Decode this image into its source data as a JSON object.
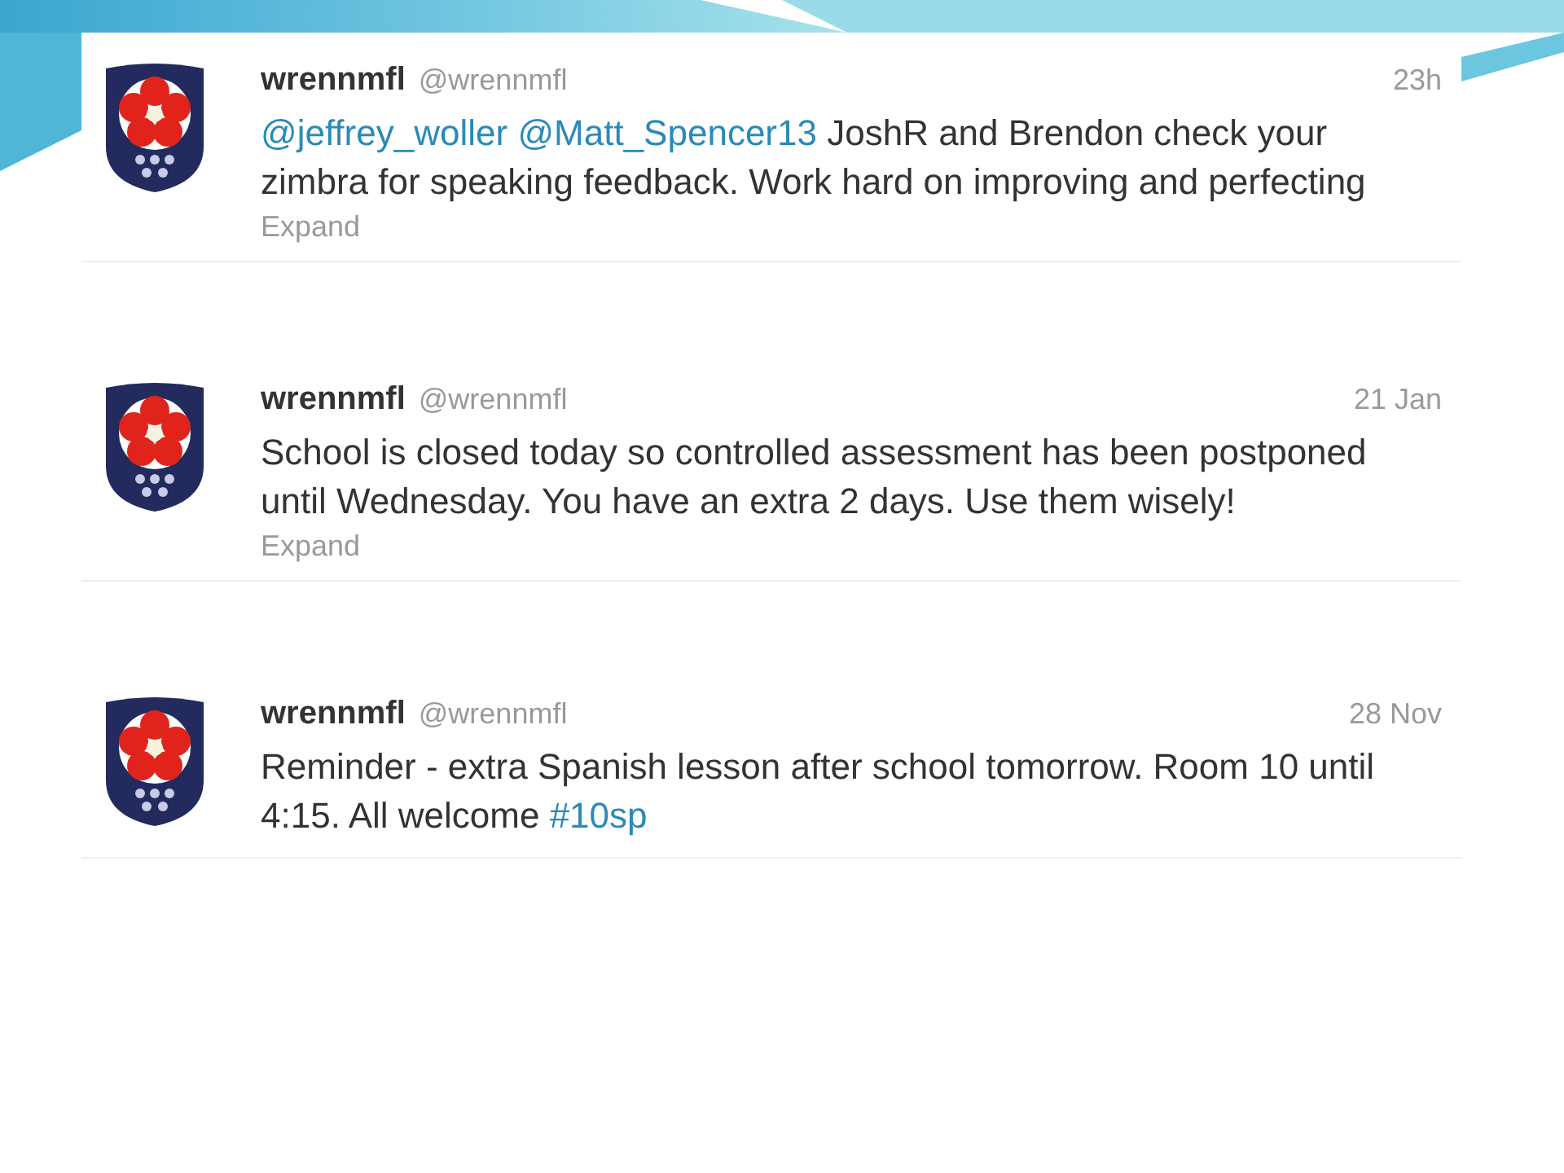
{
  "tweets": [
    {
      "name": "wrennmfl",
      "handle": "@wrennmfl",
      "time": "23h",
      "segments": [
        {
          "kind": "mention",
          "text": "@jeffrey_woller"
        },
        {
          "kind": "mention",
          "text": "@Matt_Spencer13"
        },
        {
          "kind": "text",
          "text": " JoshR and Brendon check your zimbra for speaking feedback. Work hard on improving and perfecting"
        }
      ],
      "expand": "Expand"
    },
    {
      "name": "wrennmfl",
      "handle": "@wrennmfl",
      "time": "21 Jan",
      "segments": [
        {
          "kind": "text",
          "text": "School is closed today so controlled assessment has been postponed until Wednesday. You have an extra 2 days. Use them wisely!"
        }
      ],
      "expand": "Expand"
    },
    {
      "name": "wrennmfl",
      "handle": "@wrennmfl",
      "time": "28 Nov",
      "segments": [
        {
          "kind": "text",
          "text": "Reminder - extra Spanish lesson after school tomorrow. Room 10 until 4:15. All welcome "
        },
        {
          "kind": "hashtag",
          "text": "#10sp"
        }
      ]
    }
  ]
}
